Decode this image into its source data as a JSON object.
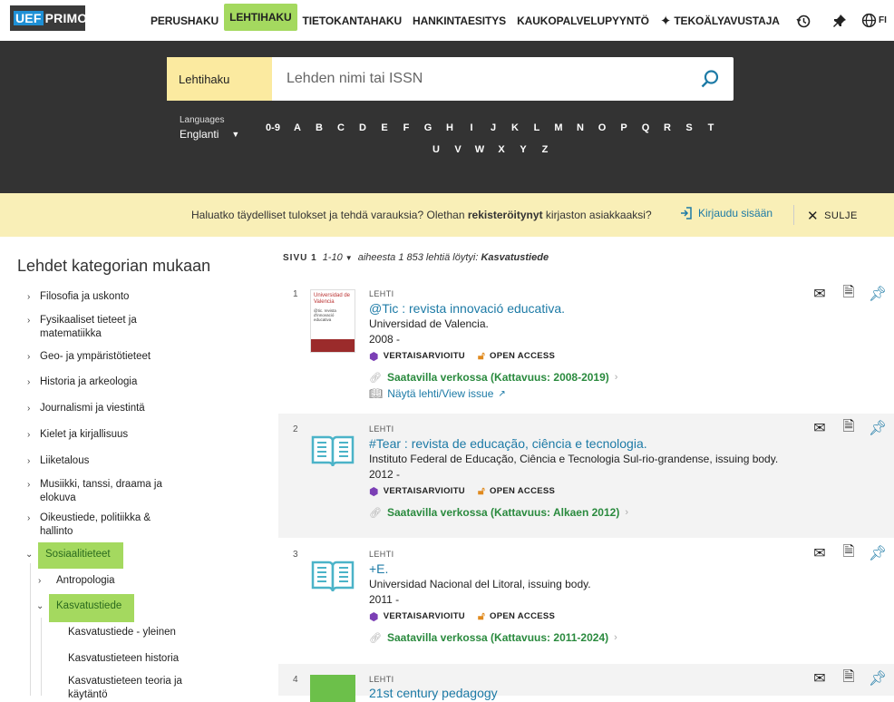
{
  "logo": {
    "left": "UEF",
    "right": "PRIMO"
  },
  "nav": {
    "items": [
      {
        "label": "PERUSHAKU",
        "active": false
      },
      {
        "label": "LEHTIHAKU",
        "active": true
      },
      {
        "label": "TIETOKANTAHAKU",
        "active": false
      },
      {
        "label": "HANKINTAESITYS",
        "active": false
      },
      {
        "label": "KAUKOPALVELUPYYNTÖ",
        "active": false
      },
      {
        "label": "TEKOÄLYAVUSTAJA",
        "active": false
      }
    ],
    "lang": "FI"
  },
  "search": {
    "scope": "Lehtihaku",
    "placeholder": "Lehden nimi tai ISSN",
    "languages_label": "Languages",
    "language_value": "Englanti",
    "alphabet": [
      "0-9",
      "A",
      "B",
      "C",
      "D",
      "E",
      "F",
      "G",
      "H",
      "I",
      "J",
      "K",
      "L",
      "M",
      "N",
      "O",
      "P",
      "Q",
      "R",
      "S",
      "T",
      "U",
      "V",
      "W",
      "X",
      "Y",
      "Z"
    ]
  },
  "notice": {
    "text_before": "Haluatko täydelliset tulokset ja tehdä varauksia? Olethan ",
    "text_bold": "rekisteröitynyt",
    "text_after": " kirjaston asiakkaaksi?",
    "login": "Kirjaudu sisään",
    "close": "SULJE"
  },
  "sidebar": {
    "title": "Lehdet kategorian mukaan",
    "categories": [
      {
        "label": "Filosofia ja uskonto"
      },
      {
        "label": "Fysikaaliset tieteet ja matematiikka"
      },
      {
        "label": "Geo- ja ympäristötieteet"
      },
      {
        "label": "Historia ja arkeologia"
      },
      {
        "label": "Journalismi ja viestintä"
      },
      {
        "label": "Kielet ja kirjallisuus"
      },
      {
        "label": "Liiketalous"
      },
      {
        "label": "Musiikki, tanssi, draama ja elokuva"
      },
      {
        "label": "Oikeustiede, politiikka & hallinto"
      },
      {
        "label": "Sosiaalitieteet"
      }
    ],
    "sub": [
      {
        "label": "Antropologia"
      },
      {
        "label": "Kasvatustiede"
      }
    ],
    "subsub": [
      {
        "label": "Kasvatustiede - yleinen"
      },
      {
        "label": "Kasvatustieteen historia"
      },
      {
        "label": "Kasvatustieteen teoria ja käytäntö"
      }
    ]
  },
  "results": {
    "page_label": "SIVU 1",
    "range": "1-10",
    "summary_prefix": "aiheesta 1 853 lehtiä löytyi:",
    "summary_topic": "Kasvatustiede",
    "items": [
      {
        "num": "1",
        "type": "LEHTI",
        "title": "@Tic : revista innovació educativa.",
        "publisher": "Universidad de Valencia.",
        "year": "2008 -",
        "peer": "VERTAISARVIOITU",
        "oa": "OPEN ACCESS",
        "avail": "Saatavilla verkossa (Kattavuus: 2008-2019)",
        "view": "Näytä lehti/View issue",
        "thumb_text": "Universidad de Valencia",
        "thumb_sub": "@tic. revista d'innovació educativa"
      },
      {
        "num": "2",
        "type": "LEHTI",
        "title": "#Tear : revista de educação, ciência e tecnologia.",
        "publisher": "Instituto Federal de Educação, Ciência e Tecnologia Sul-rio-grandense, issuing body.",
        "year": "2012 -",
        "peer": "VERTAISARVIOITU",
        "oa": "OPEN ACCESS",
        "avail": "Saatavilla verkossa (Kattavuus: Alkaen 2012)"
      },
      {
        "num": "3",
        "type": "LEHTI",
        "title": "+E.",
        "publisher": "Universidad Nacional del Litoral, issuing body.",
        "year": "2011 -",
        "peer": "VERTAISARVIOITU",
        "oa": "OPEN ACCESS",
        "avail": "Saatavilla verkossa (Kattavuus: 2011-2024)"
      },
      {
        "num": "4",
        "type": "LEHTI",
        "title": "21st century pedagogy"
      }
    ]
  },
  "colors": {
    "accent": "#1c7aa6",
    "highlight": "#a4d95f",
    "band": "#333333",
    "notice": "#f9efb7",
    "green": "#2a8a3e",
    "peer": "#7b3fb5",
    "oa": "#e08a1e"
  }
}
